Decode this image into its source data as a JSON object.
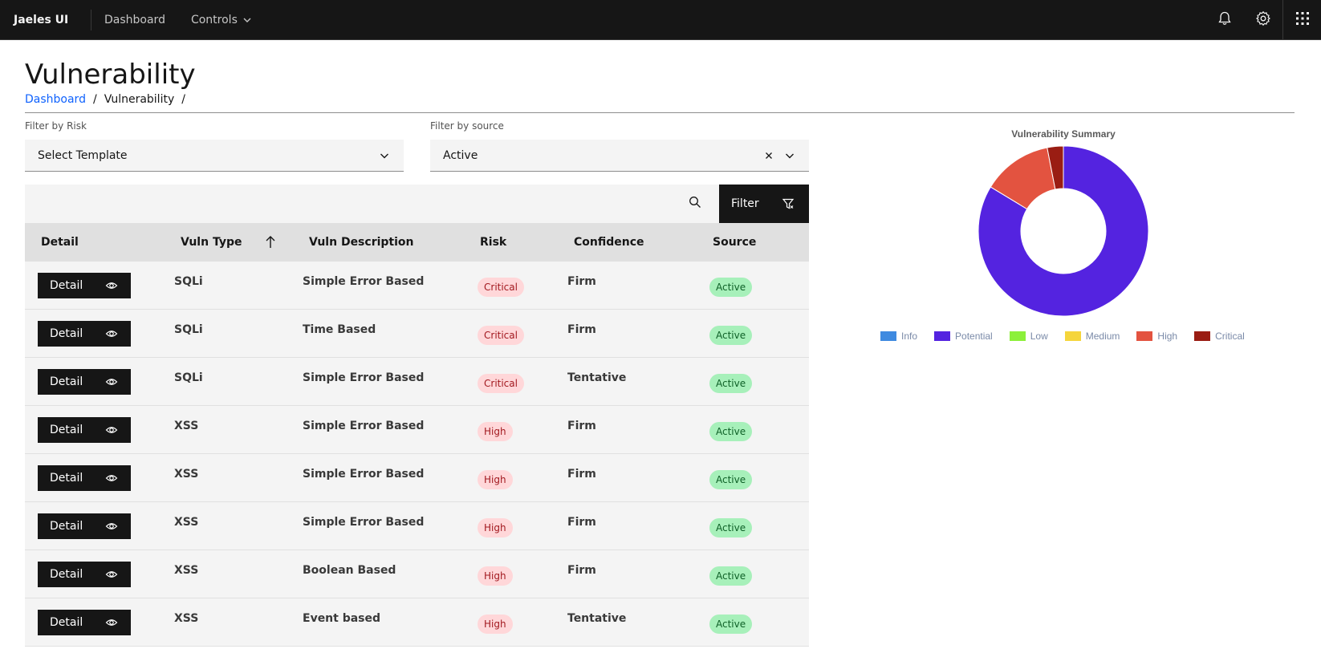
{
  "header": {
    "brand": "Jaeles UI",
    "nav": [
      {
        "label": "Dashboard"
      },
      {
        "label": "Controls"
      }
    ]
  },
  "page": {
    "title": "Vulnerability",
    "breadcrumb": [
      {
        "label": "Dashboard"
      },
      {
        "label": "Vulnerability"
      }
    ],
    "breadcrumb_separator": "/"
  },
  "filters": {
    "risk": {
      "label": "Filter by Risk",
      "value": "Select Template"
    },
    "source": {
      "label": "Filter by source",
      "value": "Active"
    }
  },
  "toolbar": {
    "filter_label": "Filter"
  },
  "table": {
    "columns": [
      "Detail",
      "Vuln Type",
      "Vuln Description",
      "Risk",
      "Confidence",
      "Source"
    ],
    "detail_label": "Detail",
    "rows": [
      {
        "type": "SQLi",
        "description": "Simple Error Based",
        "risk": "Critical",
        "confidence": "Firm",
        "source": "Active"
      },
      {
        "type": "SQLi",
        "description": "Time Based",
        "risk": "Critical",
        "confidence": "Firm",
        "source": "Active"
      },
      {
        "type": "SQLi",
        "description": "Simple Error Based",
        "risk": "Critical",
        "confidence": "Tentative",
        "source": "Active"
      },
      {
        "type": "XSS",
        "description": "Simple Error Based",
        "risk": "High",
        "confidence": "Firm",
        "source": "Active"
      },
      {
        "type": "XSS",
        "description": "Simple Error Based",
        "risk": "High",
        "confidence": "Firm",
        "source": "Active"
      },
      {
        "type": "XSS",
        "description": "Simple Error Based",
        "risk": "High",
        "confidence": "Firm",
        "source": "Active"
      },
      {
        "type": "XSS",
        "description": "Boolean Based",
        "risk": "High",
        "confidence": "Firm",
        "source": "Active"
      },
      {
        "type": "XSS",
        "description": "Event based",
        "risk": "High",
        "confidence": "Tentative",
        "source": "Active"
      }
    ]
  },
  "chart_data": {
    "type": "pie",
    "title": "Vulnerability Summary",
    "categories": [
      "Info",
      "Potential",
      "Low",
      "Medium",
      "High",
      "Critical"
    ],
    "values": [
      0,
      82,
      0,
      0,
      13,
      3
    ],
    "colors": [
      "#3f8ae0",
      "#5423e0",
      "#8cf03a",
      "#f5d53c",
      "#e35340",
      "#9a1d13"
    ],
    "legend_position": "bottom"
  }
}
